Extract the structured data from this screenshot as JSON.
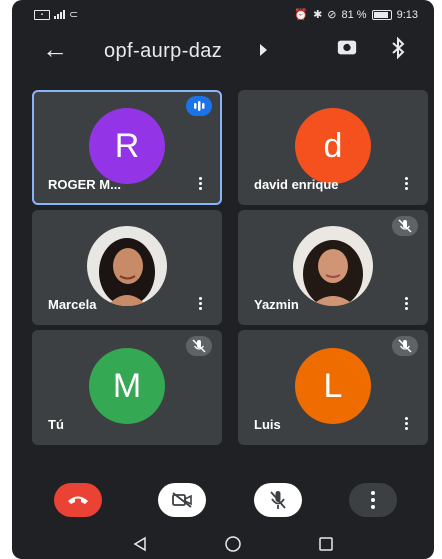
{
  "status_bar": {
    "left_icons": [
      "sim-card-icon",
      "signal-icon",
      "data-sync-icon"
    ],
    "battery_text": "81 %",
    "time": "9:13"
  },
  "header": {
    "meeting_code": "opf-aurp-daz",
    "icons": [
      "back-arrow-icon",
      "caret-right-icon",
      "switch-camera-icon",
      "bluetooth-icon"
    ]
  },
  "participants": [
    {
      "name": "ROGER M...",
      "initial": "R",
      "avatar_color": "#9334e6",
      "speaking": true,
      "muted": false,
      "type": "initial"
    },
    {
      "name": "david enrique",
      "initial": "d",
      "avatar_color": "#f4511e",
      "speaking": false,
      "muted": false,
      "type": "initial"
    },
    {
      "name": "Marcela",
      "initial": "",
      "avatar_color": "",
      "speaking": false,
      "muted": false,
      "type": "photo"
    },
    {
      "name": "Yazmin",
      "initial": "",
      "avatar_color": "",
      "speaking": false,
      "muted": true,
      "type": "photo"
    },
    {
      "name": "Tú",
      "initial": "M",
      "avatar_color": "#34a853",
      "speaking": false,
      "muted": true,
      "type": "initial"
    },
    {
      "name": "Luis",
      "initial": "L",
      "avatar_color": "#ef6c00",
      "speaking": false,
      "muted": true,
      "type": "initial"
    }
  ],
  "controls": {
    "colors": {
      "end_call": "#ea4335",
      "toggle_bg": "#ffffff",
      "more_bg": "#3c4043",
      "speaking": "#1a73e8",
      "highlight": "#8ab4f8"
    },
    "icons": [
      "end-call-icon",
      "camera-off-icon",
      "mic-off-icon",
      "more-vert-icon"
    ]
  },
  "nav_bar": {
    "icons": [
      "back-triangle-icon",
      "home-circle-icon",
      "recents-square-icon"
    ]
  }
}
